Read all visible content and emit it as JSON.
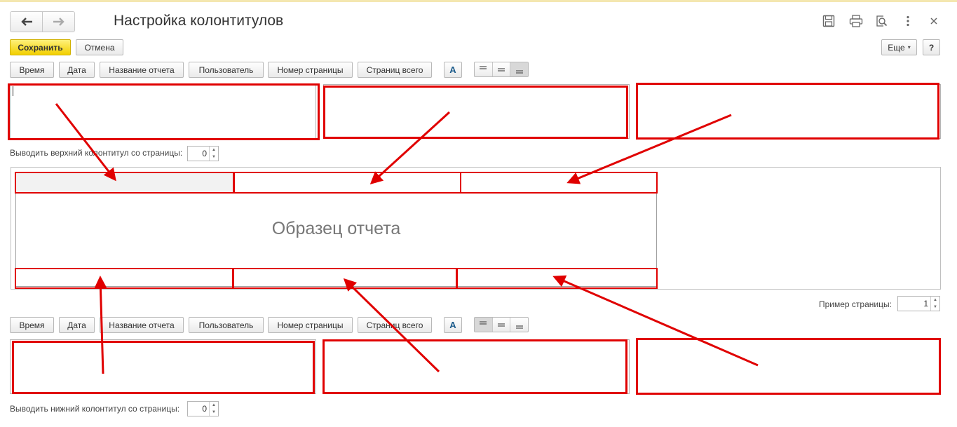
{
  "window": {
    "title": "Настройка колонтитулов",
    "icons": [
      "save-icon",
      "print-icon",
      "preview-icon",
      "more-vert-icon",
      "close-icon"
    ]
  },
  "toolbar": {
    "save_label": "Сохранить",
    "cancel_label": "Отмена",
    "more_label": "Еще",
    "help_label": "?"
  },
  "header_inserts": [
    "Время",
    "Дата",
    "Название отчета",
    "Пользователь",
    "Номер страницы",
    "Страниц всего"
  ],
  "footer_inserts": [
    "Время",
    "Дата",
    "Название отчета",
    "Пользователь",
    "Номер страницы",
    "Страниц всего"
  ],
  "header_start": {
    "label": "Выводить верхний колонтитул со страницы:",
    "value": "0"
  },
  "footer_start": {
    "label": "Выводить нижний колонтитул со страницы:",
    "value": "0"
  },
  "sample": {
    "title": "Образец отчета",
    "page_label": "Пример страницы:",
    "page_value": "1"
  },
  "colors": {
    "annotation": "#e00000",
    "save_button": "#f5d100"
  }
}
